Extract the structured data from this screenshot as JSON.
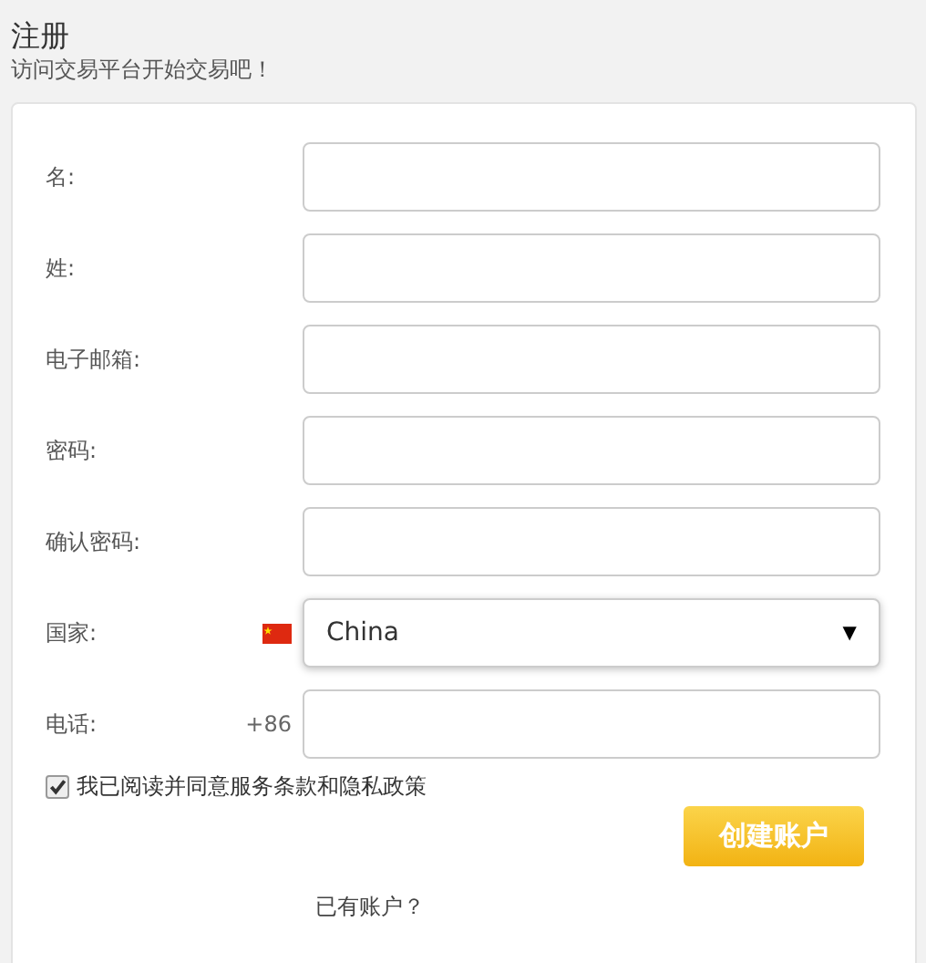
{
  "header": {
    "title": "注册",
    "subtitle": "访问交易平台开始交易吧！"
  },
  "fields": [
    {
      "label": "名:",
      "kind": "text"
    },
    {
      "label": "姓:",
      "kind": "text"
    },
    {
      "label": "电子邮箱:",
      "kind": "text"
    },
    {
      "label": "密码:",
      "kind": "text"
    },
    {
      "label": "确认密码:",
      "kind": "text"
    },
    {
      "label": "国家:",
      "kind": "select",
      "value": "China",
      "arrow": "▼"
    },
    {
      "label": "电话:",
      "kind": "phone",
      "prefix": "+86"
    }
  ],
  "agreement": {
    "label": "我已阅读并同意服务条款和隐私政策",
    "checked": true
  },
  "submit": "创建账户",
  "login_link": "已有账户？"
}
